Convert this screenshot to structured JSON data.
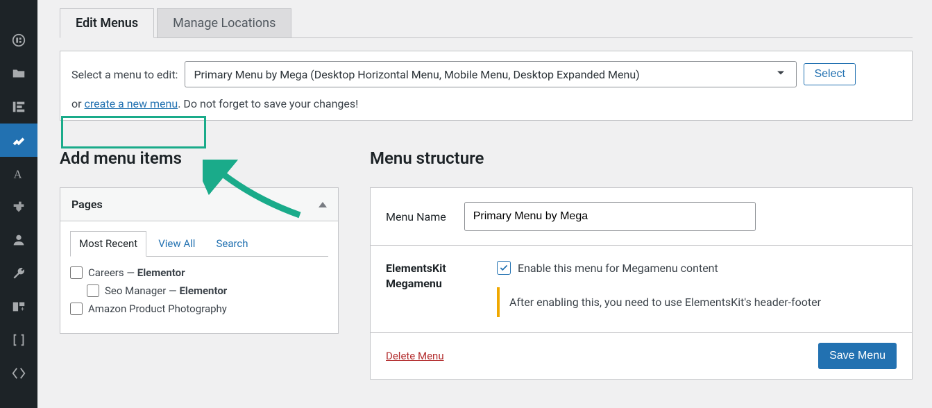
{
  "sidebar_icons": [
    "template",
    "folder",
    "elementskit",
    "appearance",
    "typography",
    "plugin",
    "user",
    "tools",
    "custom-html",
    "brackets",
    "code"
  ],
  "tabs": {
    "edit": "Edit Menus",
    "manage": "Manage Locations"
  },
  "select_panel": {
    "label": "Select a menu to edit:",
    "dropdown_value": "Primary Menu by Mega (Desktop Horizontal Menu, Mobile Menu, Desktop Expanded Menu)",
    "select_btn": "Select",
    "or_prefix": "or ",
    "create_link": "create a new menu",
    "or_suffix": ". Do not forget to save your changes!"
  },
  "left": {
    "title": "Add menu items",
    "pages_header": "Pages",
    "ptabs": {
      "recent": "Most Recent",
      "all": "View All",
      "search": "Search"
    },
    "items": [
      {
        "pre": "Careers — ",
        "bold": "Elementor",
        "indent": false
      },
      {
        "pre": "Seo Manager — ",
        "bold": "Elementor",
        "indent": true
      },
      {
        "pre": "Amazon Product Photography",
        "bold": "",
        "indent": false
      }
    ]
  },
  "right": {
    "title": "Menu structure",
    "menu_name_label": "Menu Name",
    "menu_name_value": "Primary Menu by Mega",
    "mm_label_1": "ElementsKit",
    "mm_label_2": "Megamenu",
    "mm_enable": "Enable this menu for Megamenu content",
    "mm_note": "After enabling this, you need to use ElementsKit's header-footer",
    "delete": "Delete Menu",
    "save": "Save Menu"
  }
}
